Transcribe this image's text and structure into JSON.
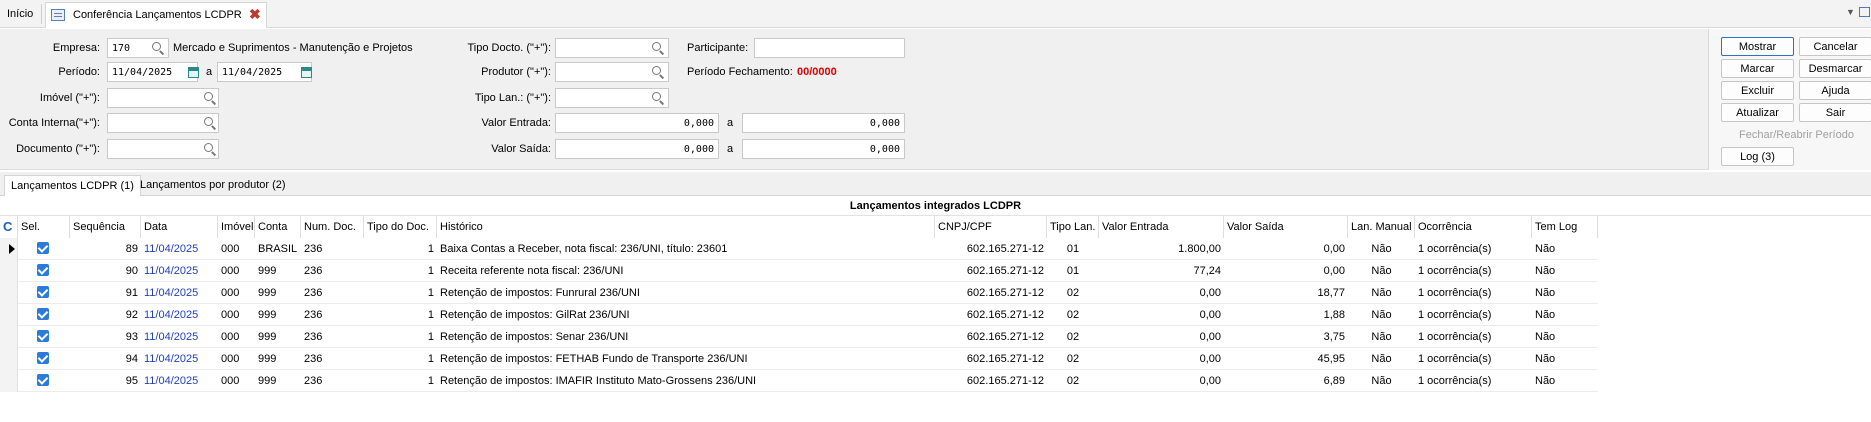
{
  "tabs": {
    "home": "Início",
    "active_title": "Conferência Lançamentos LCDPR",
    "close": "✖"
  },
  "filters": {
    "empresa_label": "Empresa:",
    "empresa_code": "170",
    "empresa_name": "Mercado e Suprimentos - Manutenção e Projetos",
    "periodo_label": "Período:",
    "periodo_from": "11/04/2025",
    "periodo_a": "a",
    "periodo_to": "11/04/2025",
    "imovel_label": "Imóvel (\"+\"):",
    "conta_label": "Conta Interna(\"+\"):",
    "documento_label": "Documento (\"+\"):",
    "tipo_docto_label": "Tipo Docto. (\"+\"):",
    "produtor_label": "Produtor (\"+\"):",
    "tipo_lan_label": "Tipo Lan.: (\"+\"):",
    "valor_entrada_label": "Valor Entrada:",
    "valor_entrada_from": "0,000",
    "valor_entrada_a": "a",
    "valor_entrada_to": "0,000",
    "valor_saida_label": "Valor Saída:",
    "valor_saida_from": "0,000",
    "valor_saida_a": "a",
    "valor_saida_to": "0,000",
    "participante_label": "Participante:",
    "periodo_fechamento_label": "Período Fechamento:",
    "periodo_fechamento_value": "00/0000"
  },
  "buttons": {
    "mostrar": "Mostrar",
    "cancelar": "Cancelar",
    "marcar": "Marcar",
    "desmarcar": "Desmarcar",
    "excluir": "Excluir",
    "ajuda": "Ajuda",
    "atualizar": "Atualizar",
    "sair": "Sair",
    "fechar_reabrir": "Fechar/Reabrir Período",
    "log": "Log (3)"
  },
  "subtabs": {
    "tab1": "Lançamentos LCDPR (1)",
    "tab2": "Lançamentos por produtor (2)"
  },
  "grid": {
    "title": "Lançamentos integrados LCDPR",
    "headers": {
      "c": "C",
      "sel": "Sel.",
      "sequencia": "Sequência",
      "data": "Data",
      "imovel": "Imóvel",
      "conta": "Conta",
      "num_doc": "Num. Doc.",
      "tipo_doc": "Tipo do Doc.",
      "historico": "Histórico",
      "cnpj": "CNPJ/CPF",
      "tipo_lan": "Tipo Lan.",
      "valor_entrada": "Valor Entrada",
      "valor_saida": "Valor Saída",
      "lan_manual": "Lan. Manual",
      "ocorrencia": "Ocorrência",
      "tem_log": "Tem Log"
    },
    "rows": [
      {
        "seq": "89",
        "data": "11/04/2025",
        "imovel": "000",
        "conta": "BRASIL",
        "num_doc": "236",
        "tipo_doc": "1",
        "historico": "Baixa Contas a Receber, nota fiscal: 236/UNI, título: 23601",
        "cnpj": "602.165.271-12",
        "tipo_lan": "01",
        "entrada": "1.800,00",
        "saida": "0,00",
        "manual": "Não",
        "ocorrencia": "1 ocorrência(s)",
        "log": "Não"
      },
      {
        "seq": "90",
        "data": "11/04/2025",
        "imovel": "000",
        "conta": "999",
        "num_doc": "236",
        "tipo_doc": "1",
        "historico": "Receita referente nota fiscal: 236/UNI",
        "cnpj": "602.165.271-12",
        "tipo_lan": "01",
        "entrada": "77,24",
        "saida": "0,00",
        "manual": "Não",
        "ocorrencia": "1 ocorrência(s)",
        "log": "Não"
      },
      {
        "seq": "91",
        "data": "11/04/2025",
        "imovel": "000",
        "conta": "999",
        "num_doc": "236",
        "tipo_doc": "1",
        "historico": "Retenção de impostos: Funrural 236/UNI",
        "cnpj": "602.165.271-12",
        "tipo_lan": "02",
        "entrada": "0,00",
        "saida": "18,77",
        "manual": "Não",
        "ocorrencia": "1 ocorrência(s)",
        "log": "Não"
      },
      {
        "seq": "92",
        "data": "11/04/2025",
        "imovel": "000",
        "conta": "999",
        "num_doc": "236",
        "tipo_doc": "1",
        "historico": "Retenção de impostos: GilRat 236/UNI",
        "cnpj": "602.165.271-12",
        "tipo_lan": "02",
        "entrada": "0,00",
        "saida": "1,88",
        "manual": "Não",
        "ocorrencia": "1 ocorrência(s)",
        "log": "Não"
      },
      {
        "seq": "93",
        "data": "11/04/2025",
        "imovel": "000",
        "conta": "999",
        "num_doc": "236",
        "tipo_doc": "1",
        "historico": "Retenção de impostos: Senar 236/UNI",
        "cnpj": "602.165.271-12",
        "tipo_lan": "02",
        "entrada": "0,00",
        "saida": "3,75",
        "manual": "Não",
        "ocorrencia": "1 ocorrência(s)",
        "log": "Não"
      },
      {
        "seq": "94",
        "data": "11/04/2025",
        "imovel": "000",
        "conta": "999",
        "num_doc": "236",
        "tipo_doc": "1",
        "historico": "Retenção de impostos: FETHAB Fundo de Transporte 236/UNI",
        "cnpj": "602.165.271-12",
        "tipo_lan": "02",
        "entrada": "0,00",
        "saida": "45,95",
        "manual": "Não",
        "ocorrencia": "1 ocorrência(s)",
        "log": "Não"
      },
      {
        "seq": "95",
        "data": "11/04/2025",
        "imovel": "000",
        "conta": "999",
        "num_doc": "236",
        "tipo_doc": "1",
        "historico": "Retenção de impostos: IMAFIR Instituto Mato-Grossens 236/UNI",
        "cnpj": "602.165.271-12",
        "tipo_lan": "02",
        "entrada": "0,00",
        "saida": "6,89",
        "manual": "Não",
        "ocorrencia": "1 ocorrência(s)",
        "log": "Não"
      }
    ]
  }
}
